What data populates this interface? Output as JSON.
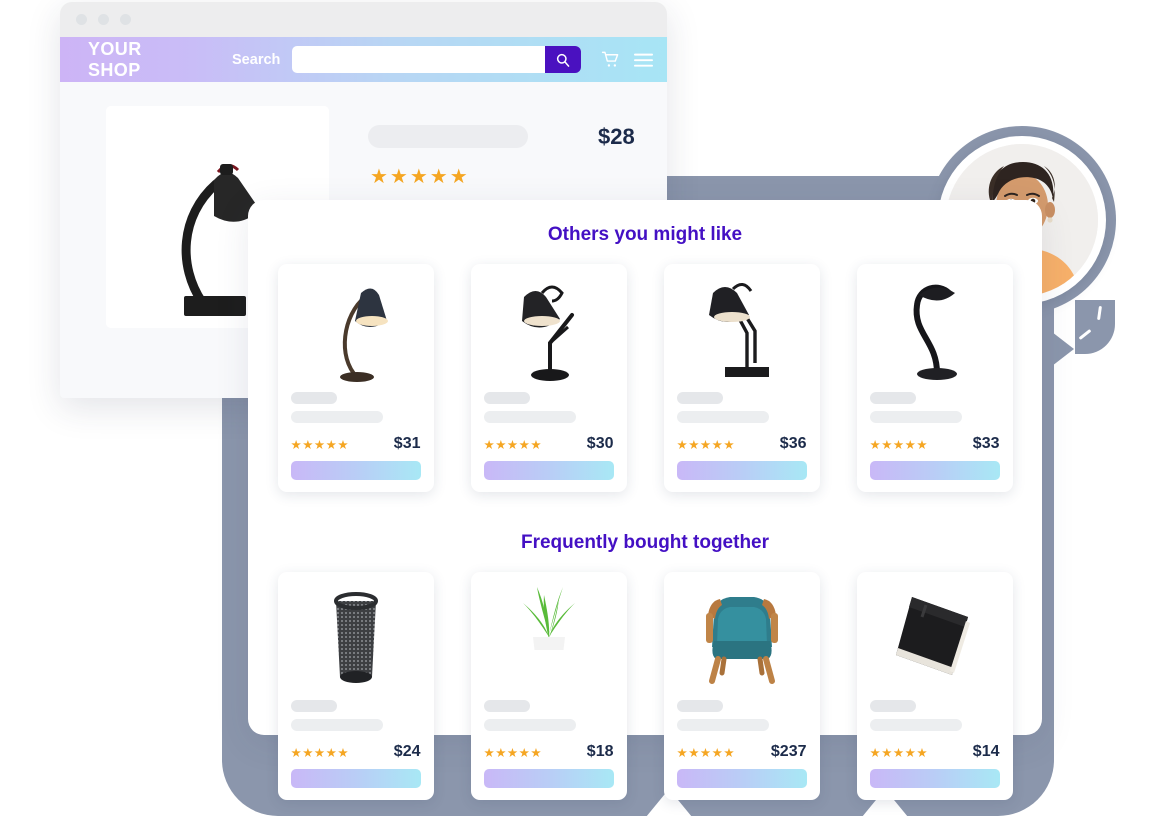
{
  "window": {
    "dots": [
      "dot-red",
      "dot-yellow",
      "dot-green"
    ],
    "brand": "YOUR SHOP",
    "search_label": "Search",
    "search_value": "",
    "search_placeholder": "",
    "search_icon": "search-icon",
    "cart_icon": "cart-icon",
    "menu_icon": "hamburger-menu-icon"
  },
  "product": {
    "image_alt": "black-desk-lamp",
    "title_placeholder": "",
    "price": "$28",
    "stars": "★★★★★",
    "rating": 5
  },
  "colors": {
    "heading_purple": "#4410c4",
    "price_navy": "#1c2b4a",
    "star_orange": "#f5a623",
    "backdrop_slate": "#8b96ac",
    "nav_gradient_start": "#cdb4f6",
    "nav_gradient_end": "#a7e5f5",
    "search_button": "#4a11c0",
    "button_gradient_start": "#c9b8f7",
    "button_gradient_end": "#a8e8f5"
  },
  "avatar": {
    "name": "customer-avatar",
    "alt": "woman-with-short-dark-hair-in-orange-top"
  },
  "sections": [
    {
      "id": "others-you-might-like",
      "heading": "Others you might like",
      "cards": [
        {
          "image": "gooseneck-desk-lamp",
          "stars": "★★★★★",
          "rating": 5,
          "price": "$31",
          "title_placeholder": "",
          "button_label": ""
        },
        {
          "image": "articulated-arm-lamp",
          "stars": "★★★★★",
          "rating": 5,
          "price": "$30",
          "title_placeholder": "",
          "button_label": ""
        },
        {
          "image": "architect-swing-arm-lamp",
          "stars": "★★★★★",
          "rating": 5,
          "price": "$36",
          "title_placeholder": "",
          "button_label": ""
        },
        {
          "image": "led-curved-desk-lamp",
          "stars": "★★★★★",
          "rating": 5,
          "price": "$33",
          "title_placeholder": "",
          "button_label": ""
        }
      ]
    },
    {
      "id": "frequently-bought-together",
      "heading": "Frequently bought together",
      "cards": [
        {
          "image": "mesh-wastebasket",
          "stars": "★★★★★",
          "rating": 5,
          "price": "$24",
          "title_placeholder": "",
          "button_label": ""
        },
        {
          "image": "potted-grass-plant",
          "stars": "★★★★★",
          "rating": 5,
          "price": "$18",
          "title_placeholder": "",
          "button_label": ""
        },
        {
          "image": "teal-armchair",
          "stars": "★★★★★",
          "rating": 5,
          "price": "$237",
          "title_placeholder": "",
          "button_label": ""
        },
        {
          "image": "black-notebook",
          "stars": "★★★★★",
          "rating": 5,
          "price": "$14",
          "title_placeholder": "",
          "button_label": ""
        }
      ]
    }
  ]
}
